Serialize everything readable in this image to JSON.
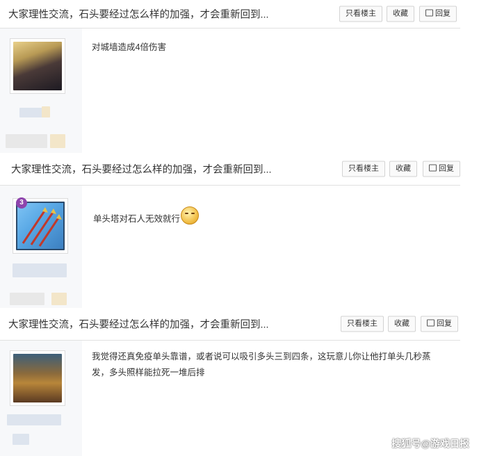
{
  "thread_title": "大家理性交流，石头要经过怎么样的加强，才会重新回到...",
  "buttons": {
    "only_op": "只看楼主",
    "favorite": "收藏",
    "reply": "回复"
  },
  "posts": [
    {
      "content": "对城墙造成4倍伤害"
    },
    {
      "content": "单头塔对石人无效就行",
      "level_badge": "3"
    },
    {
      "content": "我觉得还真免疫单头靠谱，或者说可以吸引多头三到四条，这玩意儿你让他打单头几秒蒸发，多头照样能拉死一堆后排"
    }
  ],
  "watermark": "搜狐号@游戏日报"
}
